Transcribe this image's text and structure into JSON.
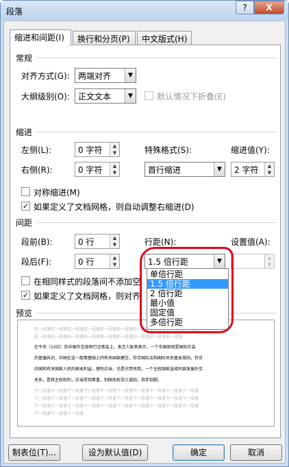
{
  "window": {
    "title": "段落",
    "help_label": "?",
    "close_label": "X"
  },
  "tabs": [
    {
      "label": "缩进和间距(I)"
    },
    {
      "label": "换行和分页(P)"
    },
    {
      "label": "中文版式(H)"
    }
  ],
  "general": {
    "section_label": "常规",
    "alignment_label": "对齐方式(G):",
    "alignment_value": "两端对齐",
    "outline_label": "大纲级别(O):",
    "outline_value": "正文文本",
    "collapse_label": "默认情况下折叠(E)"
  },
  "indent": {
    "section_label": "缩进",
    "left_label": "左侧(L):",
    "left_value": "0 字符",
    "right_label": "右侧(R):",
    "right_value": "0 字符",
    "special_label": "特殊格式(S):",
    "special_value": "首行缩进",
    "by_label": "缩进值(Y):",
    "by_value": "2 字符",
    "mirror_label": "对称缩进(M)",
    "auto_adjust_label": "如果定义了文档网格，则自动调整右缩进(D)"
  },
  "spacing": {
    "section_label": "间距",
    "before_label": "段前(B):",
    "before_value": "0 行",
    "after_label": "段后(F):",
    "after_value": "0 行",
    "line_spacing_label": "行距(N):",
    "line_spacing_value": "1.5 倍行距",
    "at_label": "设置值(A):",
    "no_space_label": "在相同样式的段落间不添加空",
    "snap_grid_label": "如果定义了文档网格，则对齐",
    "options": [
      "单倍行距",
      "1.5 倍行距",
      "2 倍行距",
      "最小值",
      "固定值",
      "多倍行距"
    ]
  },
  "preview": {
    "section_label": "预览",
    "prev_lines": [
      "前一段落前一段落前一段落前一段落前一段落前一段落前一段落前一段落前一段落前一段落",
      "前一段落前一段落前一段落前一段落前一段落前一段落前一段落前一段落前一段落"
    ],
    "body_lines": [
      "在今天（10日）的中国外交部例行记者会上，发言人耿爽表示，一个中国原则是国际社会",
      "的普遍共识，中国在这一政策基础上同有关国家建交，符合国际法和国际关系基本准则，符合",
      "中国和有关国家人民的根本利益，理所应当，也是大势所趋。一个主权国家选择同谁发展外交",
      "关系，是其主权权利，应当受到尊重，别国无权说三道四，指手划脚。"
    ],
    "next_lines": [
      "下一段落下一段落下一段落下一段落下一段落下一段落下一段落下一段落下一段落下一段落",
      "下一段落下一段落下一段落下一段落下一段落下一段落下一段落下一段落下一段落下一段落",
      "下一段落下一段落下一段落下一段落下一段落下一段落下一段落下一段落下一段落下一段落",
      "下一段落下一段落下一段落"
    ]
  },
  "buttons": {
    "tabs": "制表位(T)...",
    "default": "设为默认值(D)",
    "ok": "确定",
    "cancel": "取消"
  }
}
